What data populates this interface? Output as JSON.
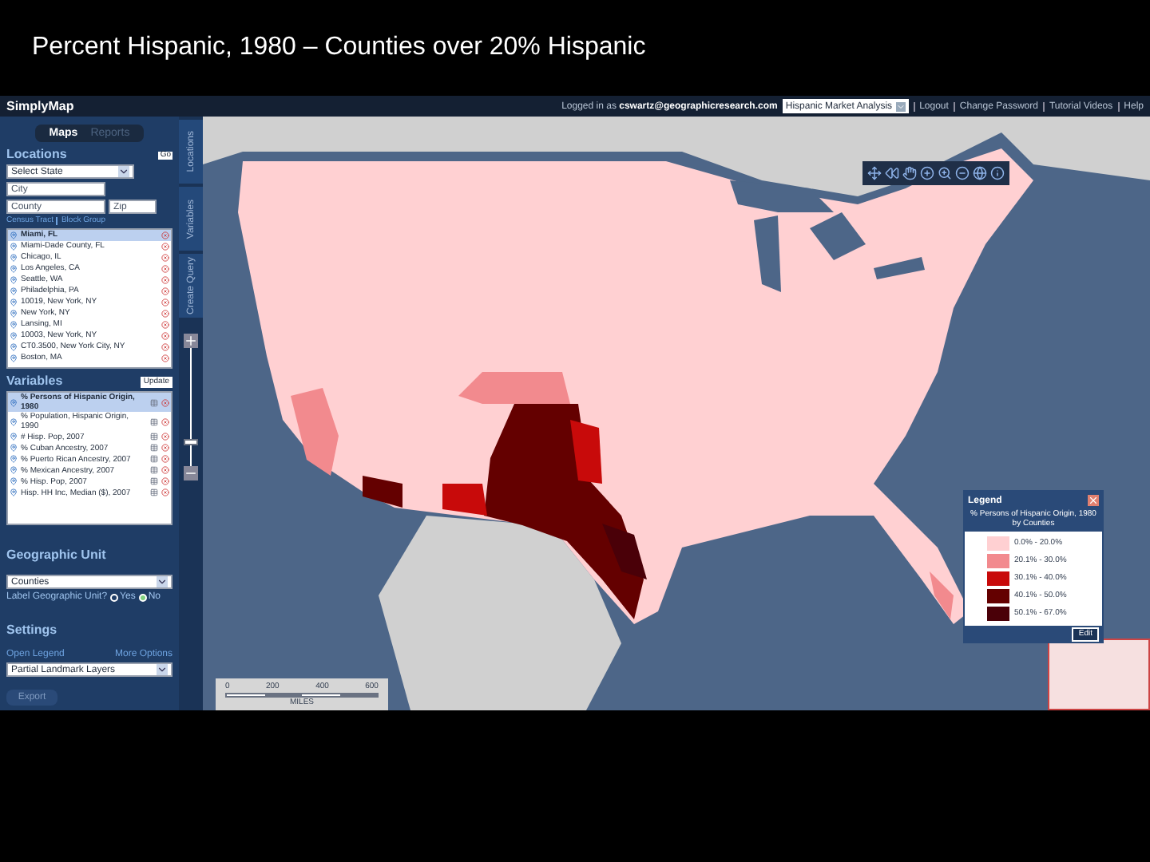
{
  "slide_title": "Percent Hispanic, 1980 – Counties over 20% Hispanic",
  "app": {
    "logo": "SimplyMap",
    "login_prefix": "Logged in as",
    "user": "cswartz@geographicresearch.com",
    "project": "Hispanic Market Analysis",
    "links": [
      "Logout",
      "Change Password",
      "Tutorial Videos",
      "Help"
    ]
  },
  "tabs": [
    {
      "label": "Maps",
      "selected": true
    },
    {
      "label": "Reports",
      "selected": false
    }
  ],
  "side_tabs": [
    "Locations",
    "Variables",
    "Create Query"
  ],
  "locations": {
    "heading": "Locations",
    "go": "Go",
    "state": "Select State",
    "city": {
      "placeholder": "City"
    },
    "county": {
      "placeholder": "County"
    },
    "zip": {
      "placeholder": "Zip"
    },
    "links": [
      "Census Tract",
      "Block Group"
    ],
    "items": [
      {
        "label": "Miami, FL",
        "selected": true
      },
      {
        "label": "Miami-Dade County, FL",
        "selected": false
      },
      {
        "label": "Chicago, IL",
        "selected": false
      },
      {
        "label": "Los Angeles, CA",
        "selected": false
      },
      {
        "label": "Seattle, WA",
        "selected": false
      },
      {
        "label": "Philadelphia, PA",
        "selected": false
      },
      {
        "label": "10019, New York, NY",
        "selected": false
      },
      {
        "label": "New York, NY",
        "selected": false
      },
      {
        "label": "Lansing, MI",
        "selected": false
      },
      {
        "label": "10003, New York, NY",
        "selected": false
      },
      {
        "label": "CT0.3500, New York City, NY",
        "selected": false
      },
      {
        "label": "Boston, MA",
        "selected": false
      }
    ]
  },
  "variables": {
    "heading": "Variables",
    "update": "Update",
    "items": [
      {
        "label": "% Persons of Hispanic Origin, 1980",
        "selected": true
      },
      {
        "label": "% Population, Hispanic Origin, 1990",
        "selected": false
      },
      {
        "label": "# Hisp. Pop, 2007",
        "selected": false
      },
      {
        "label": "% Cuban Ancestry, 2007",
        "selected": false
      },
      {
        "label": "% Puerto Rican Ancestry, 2007",
        "selected": false
      },
      {
        "label": "% Mexican Ancestry, 2007",
        "selected": false
      },
      {
        "label": "% Hisp. Pop, 2007",
        "selected": false
      },
      {
        "label": "Hisp. HH Inc, Median ($), 2007",
        "selected": false
      }
    ]
  },
  "geographic_unit": {
    "heading": "Geographic Unit",
    "select": "Counties",
    "label": "Label Geographic Unit?",
    "options": [
      {
        "label": "Yes",
        "selected": false
      },
      {
        "label": "No",
        "selected": true
      }
    ]
  },
  "settings": {
    "heading": "Settings",
    "links": [
      "Open Legend",
      "More Options"
    ],
    "select": "Partial Landmark Layers",
    "export": "Export"
  },
  "legend": {
    "title": "Legend",
    "subtitle": "% Persons of Hispanic Origin, 1980 by Counties",
    "items": [
      {
        "label": "0.0% - 20.0%",
        "color": "#ffd0d2"
      },
      {
        "label": "20.1% - 30.0%",
        "color": "#f28a8e"
      },
      {
        "label": "30.1% - 40.0%",
        "color": "#c80a0a"
      },
      {
        "label": "40.1% - 50.0%",
        "color": "#640000"
      },
      {
        "label": "50.1% - 67.0%",
        "color": "#4a0008"
      }
    ],
    "edit": "Edit"
  },
  "zoom_slider": {
    "level": 0.2
  },
  "scale": {
    "ticks": [
      "0",
      "200",
      "400",
      "600"
    ],
    "unit": "MILES"
  }
}
